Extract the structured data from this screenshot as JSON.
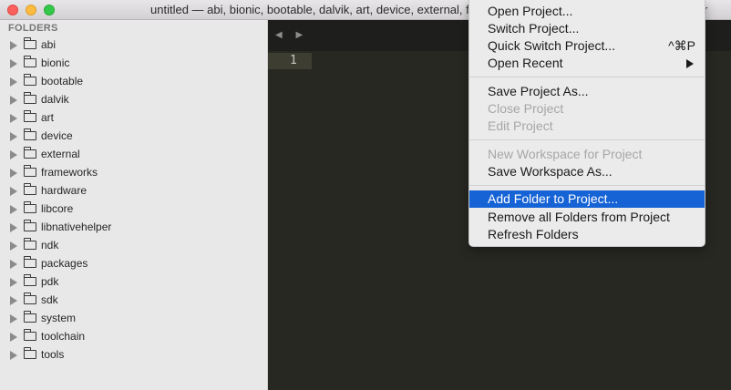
{
  "window": {
    "title": "untitled — abi, bionic, bootable, dalvik, art, device, external, frameworks, hardware, libcore, libnativehelper"
  },
  "sidebar": {
    "header": "FOLDERS",
    "folders": [
      "abi",
      "bionic",
      "bootable",
      "dalvik",
      "art",
      "device",
      "external",
      "frameworks",
      "hardware",
      "libcore",
      "libnativehelper",
      "ndk",
      "packages",
      "pdk",
      "sdk",
      "system",
      "toolchain",
      "tools"
    ]
  },
  "editor": {
    "nav_arrows": "◀ ▶",
    "line_number": "1"
  },
  "menu": {
    "open_project": "Open Project...",
    "switch_project": "Switch Project...",
    "quick_switch_project": "Quick Switch Project...",
    "quick_switch_shortcut": "^⌘P",
    "open_recent": "Open Recent",
    "save_project_as": "Save Project As...",
    "close_project": "Close Project",
    "edit_project": "Edit Project",
    "new_workspace": "New Workspace for Project",
    "save_workspace_as": "Save Workspace As...",
    "add_folder": "Add Folder to Project...",
    "remove_all_folders": "Remove all Folders from Project",
    "refresh_folders": "Refresh Folders"
  },
  "colors": {
    "highlight": "#1663d6",
    "editor_bg": "#272822",
    "sidebar_bg": "#e8e8e8"
  }
}
